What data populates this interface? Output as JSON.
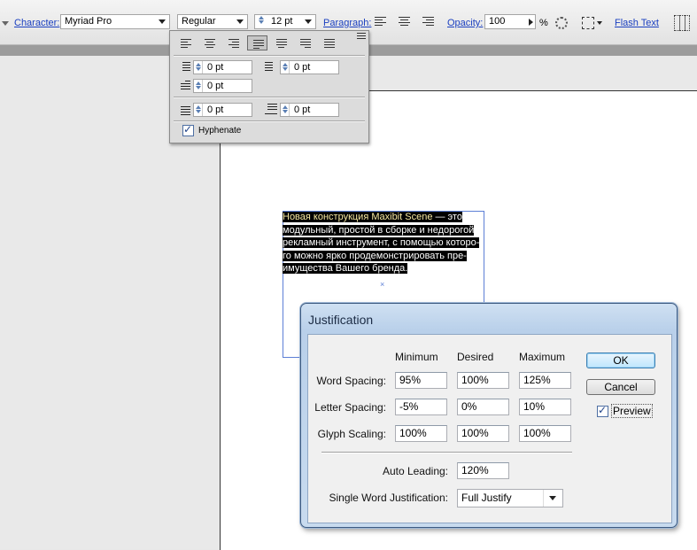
{
  "control_bar": {
    "character_label": "Character:",
    "font_family": "Myriad Pro",
    "font_style": "Regular",
    "font_size": "12 pt",
    "paragraph_label": "Paragraph:",
    "opacity_label": "Opacity:",
    "opacity_value": "100",
    "opacity_unit": "%",
    "flash_text_label": "Flash Text"
  },
  "paragraph_popup": {
    "left_indent": "0 pt",
    "right_indent": "0 pt",
    "first_line_indent": "0 pt",
    "space_before": "0 pt",
    "space_after": "0 pt",
    "hyphenate_label": "Hyphenate",
    "hyphenate_checked": true
  },
  "document": {
    "line1_a": "Новая конструкция Maxibit Scene",
    "line1_b": " — это",
    "line2": "модульный, простой в сборке и недорогой",
    "line3": "рекламный инструмент, с помощью которо-",
    "line4": "го можно ярко продемонстрировать пре-",
    "line5": "имущества Вашего бренда."
  },
  "dialog": {
    "title": "Justification",
    "col_minimum": "Minimum",
    "col_desired": "Desired",
    "col_maximum": "Maximum",
    "rows": [
      {
        "label": "Word Spacing:",
        "min": "95%",
        "desired": "100%",
        "max": "125%"
      },
      {
        "label": "Letter Spacing:",
        "min": "-5%",
        "desired": "0%",
        "max": "10%"
      },
      {
        "label": "Glyph Scaling:",
        "min": "100%",
        "desired": "100%",
        "max": "100%"
      }
    ],
    "auto_leading_label": "Auto Leading:",
    "auto_leading_value": "120%",
    "swj_label": "Single Word Justification:",
    "swj_value": "Full Justify",
    "ok_label": "OK",
    "cancel_label": "Cancel",
    "preview_label": "Preview",
    "preview_checked": true
  }
}
